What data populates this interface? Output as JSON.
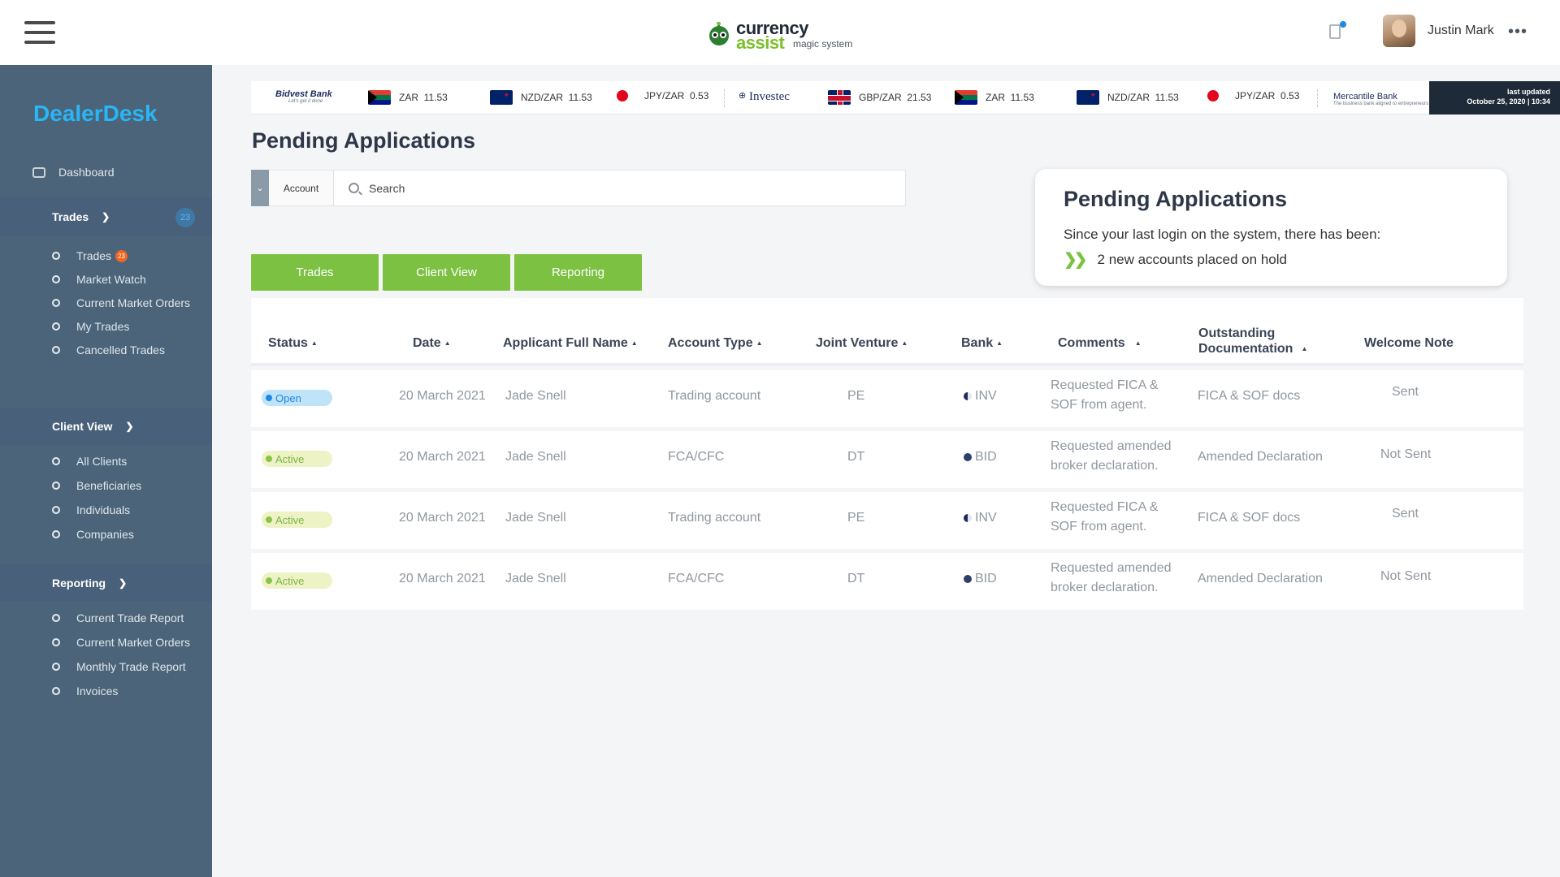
{
  "header": {
    "logo_line1": "currency",
    "logo_line2": "assist",
    "logo_tagline": "magic system",
    "user_name": "Justin Mark"
  },
  "sidebar": {
    "brand": "DealerDesk",
    "dashboard": "Dashboard",
    "trades_section": {
      "label": "Trades",
      "count": "23"
    },
    "trades_items": [
      {
        "label": "Trades",
        "badge": "23"
      },
      {
        "label": "Market Watch"
      },
      {
        "label": "Current Market Orders"
      },
      {
        "label": "My Trades"
      },
      {
        "label": "Cancelled Trades"
      }
    ],
    "client_section": {
      "label": "Client View"
    },
    "client_items": [
      {
        "label": "All Clients"
      },
      {
        "label": "Beneficiaries"
      },
      {
        "label": "Individuals"
      },
      {
        "label": "Companies"
      }
    ],
    "reporting_section": {
      "label": "Reporting"
    },
    "reporting_items": [
      {
        "label": "Current Trade Report"
      },
      {
        "label": "Current Market Orders"
      },
      {
        "label": "Monthly Trade Report"
      },
      {
        "label": "Invoices"
      }
    ]
  },
  "ticker": {
    "banks": {
      "bidvest": "Bidvest Bank",
      "bidvest_sub": "Let's get it done",
      "investec": "Investec",
      "mercantile": "Mercantile Bank",
      "mercantile_sub": "The business bank aligned to entrepreneurs"
    },
    "rates": [
      {
        "pair": "ZAR",
        "value": "11.53"
      },
      {
        "pair": "NZD/ZAR",
        "value": "11.53"
      },
      {
        "pair": "JPY/ZAR",
        "value": "0.53"
      },
      {
        "pair": "GBP/ZAR",
        "value": "21.53"
      },
      {
        "pair": "ZAR",
        "value": "11.53"
      },
      {
        "pair": "NZD/ZAR",
        "value": "11.53"
      },
      {
        "pair": "JPY/ZAR",
        "value": "0.53"
      }
    ],
    "last_updated_label": "last updated",
    "last_updated_value": "October 25, 2020 | 10:34"
  },
  "main": {
    "title": "Pending Applications",
    "search": {
      "account_label": "Account",
      "placeholder": "Search"
    },
    "buttons": {
      "trades": "Trades",
      "client_view": "Client View",
      "reporting": "Reporting"
    }
  },
  "notice": {
    "title": "Pending Applications",
    "text": "Since your last login on the system, there has been:",
    "item": "2 new accounts placed on hold"
  },
  "table": {
    "columns": {
      "status": "Status",
      "date": "Date",
      "applicant": "Applicant Full Name",
      "account_type": "Account Type",
      "joint_venture": "Joint Venture",
      "bank": "Bank",
      "comments": "Comments",
      "outstanding_1": "Outstanding",
      "outstanding_2": "Documentation",
      "welcome_note": "Welcome Note"
    },
    "rows": [
      {
        "status": "Open",
        "date": "20 March 2021",
        "applicant": "Jade Snell",
        "account_type": "Trading account",
        "joint_venture": "PE",
        "bank": "INV",
        "comments": "Requested FICA & SOF from agent.",
        "documentation": "FICA & SOF docs",
        "welcome_note": "Sent"
      },
      {
        "status": "Active",
        "date": "20 March 2021",
        "applicant": "Jade Snell",
        "account_type": "FCA/CFC",
        "joint_venture": "DT",
        "bank": "BID",
        "comments": "Requested amended broker declaration.",
        "documentation": "Amended Declaration",
        "welcome_note": "Not Sent"
      },
      {
        "status": "Active",
        "date": "20 March 2021",
        "applicant": "Jade Snell",
        "account_type": "Trading account",
        "joint_venture": "PE",
        "bank": "INV",
        "comments": "Requested FICA & SOF from agent.",
        "documentation": "FICA & SOF docs",
        "welcome_note": "Sent"
      },
      {
        "status": "Active",
        "date": "20 March 2021",
        "applicant": "Jade Snell",
        "account_type": "FCA/CFC",
        "joint_venture": "DT",
        "bank": "BID",
        "comments": "Requested amended broker declaration.",
        "documentation": "Amended Declaration",
        "welcome_note": "Not Sent"
      }
    ]
  },
  "colors": {
    "sidebar": "#4b6479",
    "brand": "#29b6f6",
    "accent_green": "#7cc142",
    "badge_orange": "#f26522"
  }
}
